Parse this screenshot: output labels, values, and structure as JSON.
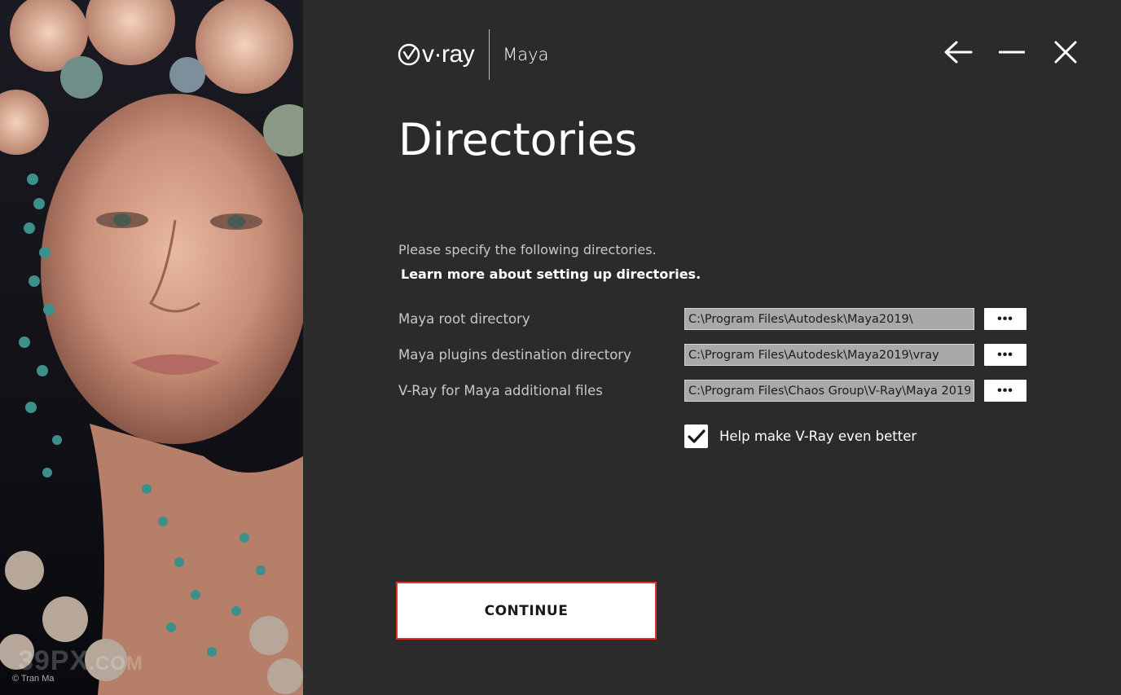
{
  "artwork": {
    "credit": "© Tran Ma",
    "watermark_main": "39PX",
    "watermark_suffix": ".COM"
  },
  "header": {
    "logo_text": "v·ray",
    "product": "Maya"
  },
  "window_controls": {
    "back_icon": "arrow-left-icon",
    "minimize_icon": "minimize-icon",
    "close_icon": "close-icon"
  },
  "page": {
    "title": "Directories",
    "intro": "Please specify the following directories.",
    "learn_more": "Learn more about setting up directories."
  },
  "directories": [
    {
      "label": "Maya root directory",
      "value": "C:\\Program Files\\Autodesk\\Maya2019\\",
      "browse_label": "•••"
    },
    {
      "label": "Maya plugins destination directory",
      "value": "C:\\Program Files\\Autodesk\\Maya2019\\vray",
      "browse_label": "•••"
    },
    {
      "label": "V-Ray for Maya additional files",
      "value": "C:\\Program Files\\Chaos Group\\V-Ray\\Maya 2019",
      "browse_label": "•••"
    }
  ],
  "help_improve": {
    "label": "Help make V-Ray even better",
    "checked": true
  },
  "continue_label": "CONTINUE",
  "colors": {
    "background": "#2b2b2b",
    "accent_border": "#e0302b",
    "input_bg": "#a9a9a9"
  }
}
